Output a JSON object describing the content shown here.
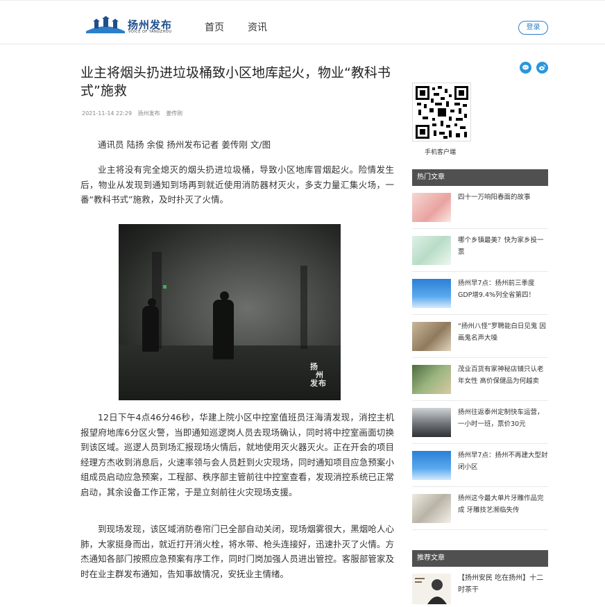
{
  "header": {
    "logo_text": "扬州发布",
    "logo_sub": "VOICE OF YANGZHOU",
    "nav": [
      "首页",
      "资讯"
    ],
    "login_label": "登录"
  },
  "article": {
    "title": "业主将烟头扔进垃圾桶致小区地库起火，物业“教科书式”施救",
    "date": "2021-11-14 22:29",
    "source": "扬州发布",
    "author": "姜传刚",
    "paragraphs": [
      "通讯员 陆扬 余俊 扬州发布记者 姜传刚 文/图",
      "业主将没有完全熄灭的烟头扔进垃圾桶，导致小区地库冒烟起火。险情发生后，物业从发现到通知到场再到就近使用消防器材灭火，多支力量汇集火场，一番“教科书式”施救，及时扑灭了火情。",
      "12日下午4点46分46秒，华建上院小区中控室值班员汪海清发现，消控主机报望府地库6分区火警，当即通知巡逻岗人员去现场确认，同时将中控室画面切换到该区域。巡逻人员到场汇报现场火情后，就地使用灭火器灭火。正在开会的项目经理方杰收到消息后，火速率领与会人员赶到火灾现场，同时通知项目应急预案小组成员启动应急预案，工程部、秩序部主管前往中控室查看，发现消控系统已正常启动，其余设备工作正常，于是立刻前往火灾现场支援。",
      "到现场发现，该区域消防卷帘门已全部自动关闭，现场烟雾很大，黑烟呛人心肺，大家挺身而出，就近打开消火栓，将水带、枪头连接好，迅速扑灭了火情。方杰通知各部门按照应急预案有序工作，同时门岗加强人员进出管控。客服部管家及时在业主群发布通知，告知事故情况，安抚业主情绪。"
    ],
    "photo_watermark": [
      "扬",
      "州",
      "发",
      "布"
    ]
  },
  "sidebar": {
    "qr_caption": "手机客户端",
    "hot_label": "热门文章",
    "hot_items": [
      "四十一万响阳春面的故事",
      "哪个乡镇最美？快为家乡投一票",
      "扬州早7点：扬州前三季度GDP增9.4%列全省第四！",
      "“扬州八怪”罗聘能白日见鬼 因画鬼名声大噪",
      "茂业百货有家神秘店铺只认老年女性 高价保健品为何越卖",
      "扬州往返泰州定制快车运营，一小时一班，票价30元",
      "扬州早7点：扬州不再建大型封闭小区",
      "扬州这今最大单片牙雕作品完成 牙雕技艺濒临失传"
    ],
    "rec_label": "推荐文章",
    "rec_items": [
      "【扬州安民 吃在扬州】十二时茶干"
    ]
  },
  "colors": {
    "accent": "#2a7fc9",
    "share": "#2a96dd",
    "section_bar": "#505050",
    "logo": "#1f4e8c"
  },
  "icons": [
    "wechat-share-icon",
    "weibo-share-icon",
    "qr-code-icon",
    "logo-bridge-icon"
  ]
}
